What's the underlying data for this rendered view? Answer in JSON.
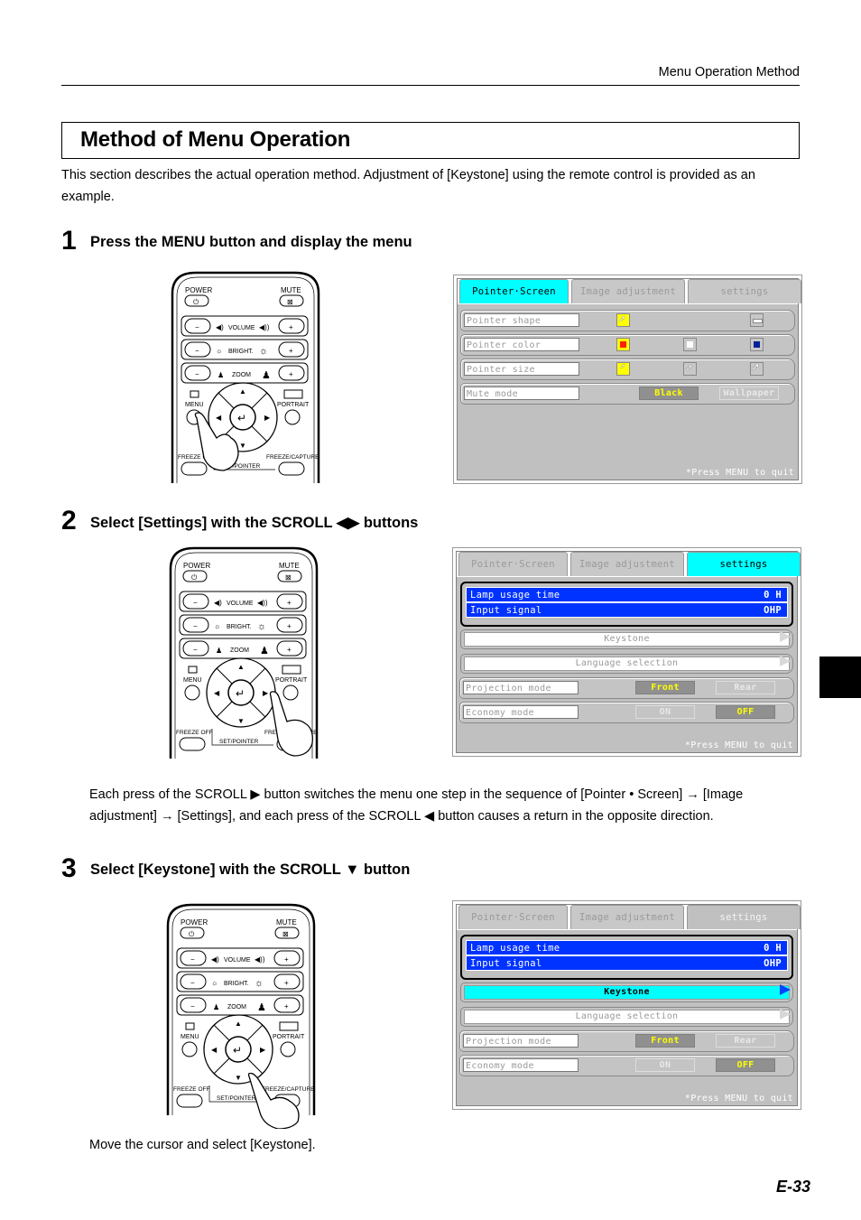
{
  "header": {
    "running_title": "Menu Operation Method"
  },
  "title": "Method of Menu Operation",
  "intro": "This section describes the actual operation method. Adjustment of [Keystone] using the remote control is provided as an example.",
  "steps": [
    {
      "number": "1",
      "title": "Press the MENU button and display the menu"
    },
    {
      "number": "2",
      "title": "Select [Settings] with the SCROLL ◀▶ buttons",
      "note": "Each press of the SCROLL ▶ button switches the menu one step in the sequence of [Pointer • Screen] → [Image adjustment] → [Settings], and each press of the SCROLL ◀ button causes a return in the opposite direction."
    },
    {
      "number": "3",
      "title": "Select [Keystone] with the SCROLL ▼ button",
      "note": "Move the cursor and select [Keystone]."
    }
  ],
  "remote": {
    "power": "POWER",
    "mute": "MUTE",
    "volume": "VOLUME",
    "bright": "BRIGHT.",
    "zoom": "ZOOM",
    "menu": "MENU",
    "portrait": "PORTRAIT",
    "freeze_off": "FREEZE OFF",
    "freeze_capture": "FREEZE/CAPTURE",
    "set_pointer": "SET/POINTER",
    "minus": "−",
    "plus": "+"
  },
  "osd": {
    "tabs": [
      "Pointer·Screen",
      "Image adjustment",
      "settings"
    ],
    "quit_hint": "*Press MENU to quit",
    "pointer_screen": {
      "rows": [
        {
          "label": "Pointer shape"
        },
        {
          "label": "Pointer color",
          "colors": [
            "#ff2200",
            "#ffffff",
            "#002299"
          ]
        },
        {
          "label": "Pointer size"
        },
        {
          "label": "Mute mode",
          "options": [
            "Black",
            "Wallpaper"
          ],
          "selected": "Black"
        }
      ]
    },
    "settings": {
      "info": [
        {
          "label": "Lamp usage time",
          "value": "0 H"
        },
        {
          "label": "Input signal",
          "value": "OHP"
        }
      ],
      "keystone": "Keystone",
      "language": "Language selection",
      "projection": {
        "label": "Projection mode",
        "options": [
          "Front",
          "Rear"
        ],
        "selected": "Front"
      },
      "economy": {
        "label": "Economy mode",
        "options": [
          "ON",
          "OFF"
        ],
        "selected": "OFF"
      }
    }
  },
  "page_number": "E-33"
}
